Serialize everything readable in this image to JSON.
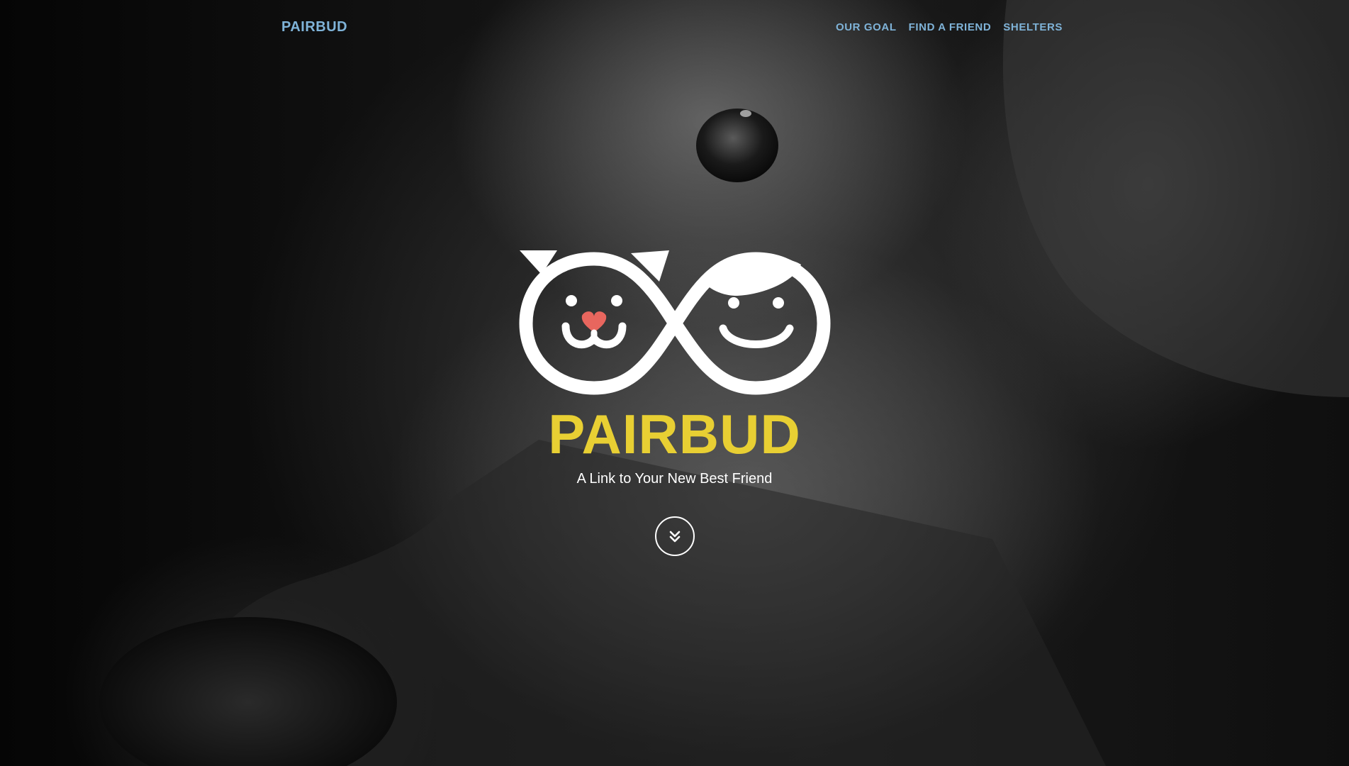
{
  "navbar": {
    "brand": "PAIRBUD",
    "links": [
      {
        "label": "OUR GOAL"
      },
      {
        "label": "FIND A FRIEND"
      },
      {
        "label": "SHELTERS"
      }
    ]
  },
  "hero": {
    "title": "PAIRBUD",
    "subtitle": "A Link to Your New Best Friend",
    "scroll_icon": "double-chevron-down-icon",
    "logo_icon": "pet-and-person-infinity-logo",
    "background": "grayscale-dog-closeup-photo"
  },
  "colors": {
    "nav_text": "#7fb3d8",
    "title": "#e8cf33",
    "subtitle": "#ffffff",
    "heart": "#e8665e",
    "logo": "#ffffff"
  }
}
